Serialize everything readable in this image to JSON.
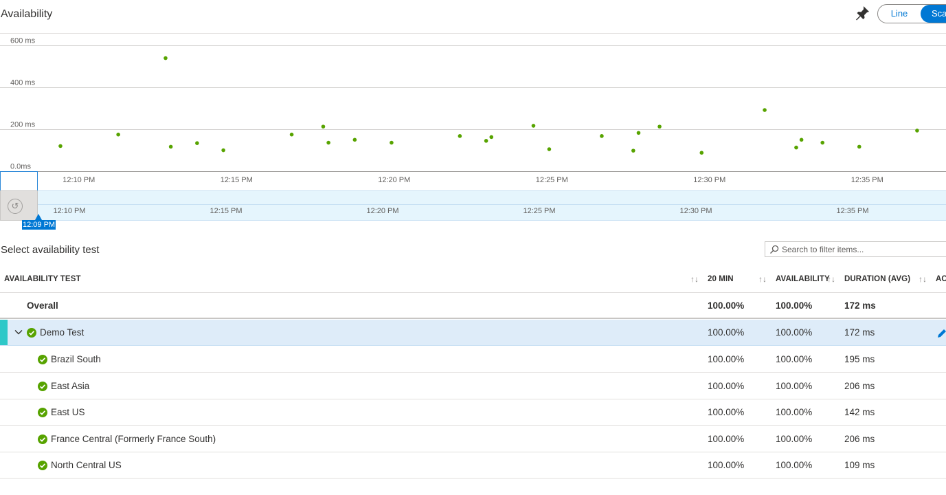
{
  "header": {
    "title": "Availability",
    "pin_icon": "pin-icon",
    "view_toggle": {
      "line_label": "Line",
      "scatter_label": "Scatter",
      "selected": "Scatter"
    }
  },
  "chart_data": {
    "type": "scatter",
    "title": "",
    "xlabel": "",
    "ylabel": "",
    "ylim": [
      0,
      660
    ],
    "yticks": [
      {
        "value": 0,
        "label": "0.0ms"
      },
      {
        "value": 200,
        "label": "200 ms"
      },
      {
        "value": 400,
        "label": "400 ms"
      },
      {
        "value": 600,
        "label": "600 ms"
      }
    ],
    "xlim": [
      "12:07:30",
      "12:37:30"
    ],
    "xticks": [
      "12:10 PM",
      "12:15 PM",
      "12:20 PM",
      "12:25 PM",
      "12:30 PM",
      "12:35 PM"
    ],
    "grid": true,
    "point_color": "#57a300",
    "series": [
      {
        "points": [
          {
            "x": "12:09:25",
            "y": 120
          },
          {
            "x": "12:11:15",
            "y": 175
          },
          {
            "x": "12:12:45",
            "y": 540
          },
          {
            "x": "12:12:55",
            "y": 117
          },
          {
            "x": "12:13:45",
            "y": 134
          },
          {
            "x": "12:14:35",
            "y": 100
          },
          {
            "x": "12:16:45",
            "y": 175
          },
          {
            "x": "12:17:45",
            "y": 213
          },
          {
            "x": "12:17:55",
            "y": 136
          },
          {
            "x": "12:18:45",
            "y": 150
          },
          {
            "x": "12:19:55",
            "y": 136
          },
          {
            "x": "12:22:05",
            "y": 168
          },
          {
            "x": "12:22:55",
            "y": 145
          },
          {
            "x": "12:23:05",
            "y": 163
          },
          {
            "x": "12:24:25",
            "y": 217
          },
          {
            "x": "12:24:55",
            "y": 105
          },
          {
            "x": "12:26:35",
            "y": 168
          },
          {
            "x": "12:27:35",
            "y": 98
          },
          {
            "x": "12:27:45",
            "y": 183
          },
          {
            "x": "12:28:25",
            "y": 213
          },
          {
            "x": "12:29:45",
            "y": 88
          },
          {
            "x": "12:31:45",
            "y": 292
          },
          {
            "x": "12:32:45",
            "y": 113
          },
          {
            "x": "12:32:55",
            "y": 150
          },
          {
            "x": "12:33:35",
            "y": 136
          },
          {
            "x": "12:34:45",
            "y": 117
          },
          {
            "x": "12:36:35",
            "y": 194
          }
        ]
      }
    ]
  },
  "time_brush": {
    "ticks": [
      "12:10 PM",
      "12:15 PM",
      "12:20 PM",
      "12:25 PM",
      "12:30 PM",
      "12:35 PM"
    ],
    "reset_icon": "reset-icon",
    "marker_label": "12:09 PM"
  },
  "tests_section": {
    "title": "Select availability test",
    "search_placeholder": "Search to filter items..."
  },
  "table": {
    "columns": [
      "AVAILABILITY TEST",
      "20 MIN",
      "AVAILABILITY",
      "DURATION (AVG)",
      "ACTIONS"
    ],
    "sort_glyph": "↑↓",
    "overall": {
      "name": "Overall",
      "min20": "100.00%",
      "availability": "100.00%",
      "duration": "172 ms"
    },
    "group": {
      "name": "Demo Test",
      "min20": "100.00%",
      "availability": "100.00%",
      "duration": "172 ms",
      "stripe_color": "#2ec8c8"
    },
    "rows": [
      {
        "name": "Brazil South",
        "min20": "100.00%",
        "availability": "100.00%",
        "duration": "195 ms"
      },
      {
        "name": "East Asia",
        "min20": "100.00%",
        "availability": "100.00%",
        "duration": "206 ms"
      },
      {
        "name": "East US",
        "min20": "100.00%",
        "availability": "100.00%",
        "duration": "142 ms"
      },
      {
        "name": "France Central (Formerly France South)",
        "min20": "100.00%",
        "availability": "100.00%",
        "duration": "206 ms"
      },
      {
        "name": "North Central US",
        "min20": "100.00%",
        "availability": "100.00%",
        "duration": "109 ms"
      }
    ]
  }
}
